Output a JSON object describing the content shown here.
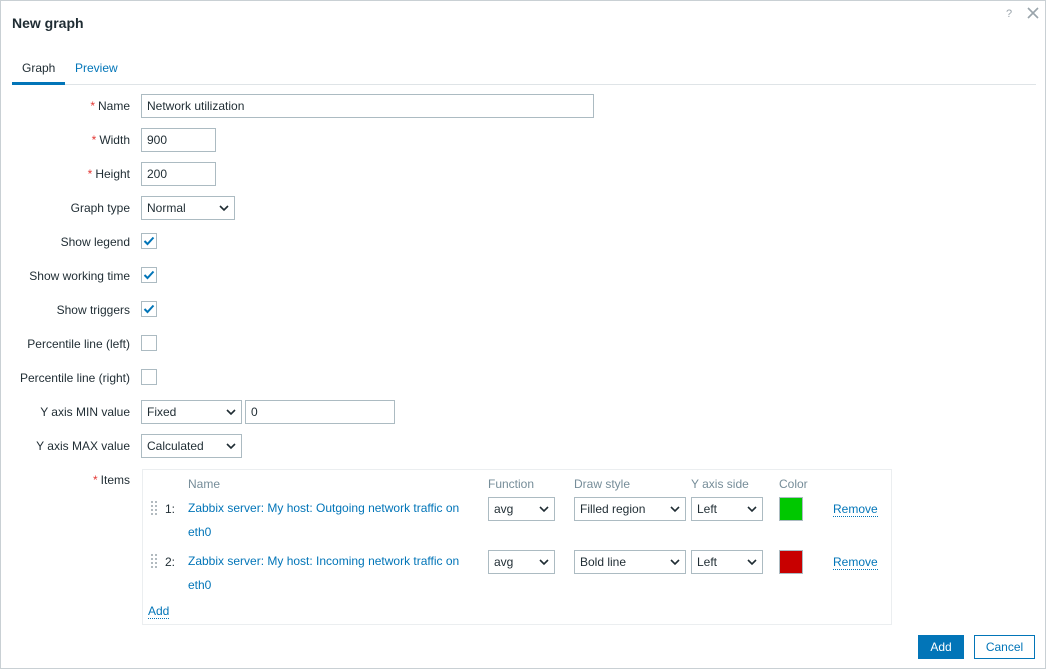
{
  "dialog": {
    "title": "New graph",
    "help": "?"
  },
  "tabs": [
    {
      "label": "Graph",
      "active": true
    },
    {
      "label": "Preview",
      "active": false
    }
  ],
  "form": {
    "name": {
      "label": "Name",
      "value": "Network utilization",
      "required": true
    },
    "width": {
      "label": "Width",
      "value": "900",
      "required": true
    },
    "height": {
      "label": "Height",
      "value": "200",
      "required": true
    },
    "graph_type": {
      "label": "Graph type",
      "value": "Normal"
    },
    "show_legend": {
      "label": "Show legend",
      "checked": true
    },
    "show_working_time": {
      "label": "Show working time",
      "checked": true
    },
    "show_triggers": {
      "label": "Show triggers",
      "checked": true
    },
    "percentile_left": {
      "label": "Percentile line (left)",
      "checked": false
    },
    "percentile_right": {
      "label": "Percentile line (right)",
      "checked": false
    },
    "y_min": {
      "label": "Y axis MIN value",
      "type": "Fixed",
      "value": "0"
    },
    "y_max": {
      "label": "Y axis MAX value",
      "type": "Calculated"
    },
    "items_label": "Items"
  },
  "items": {
    "headers": {
      "name": "Name",
      "function": "Function",
      "draw_style": "Draw style",
      "y_axis_side": "Y axis side",
      "color": "Color"
    },
    "rows": [
      {
        "num": "1:",
        "name_line1": "Zabbix server: My host: Outgoing network traffic on",
        "name_line2": "eth0",
        "function": "avg",
        "draw_style": "Filled region",
        "y_axis_side": "Left",
        "color": "#00c800",
        "remove": "Remove"
      },
      {
        "num": "2:",
        "name_line1": "Zabbix server: My host: Incoming network traffic on",
        "name_line2": "eth0",
        "function": "avg",
        "draw_style": "Bold line",
        "y_axis_side": "Left",
        "color": "#c80000",
        "remove": "Remove"
      }
    ],
    "add": "Add"
  },
  "footer": {
    "add": "Add",
    "cancel": "Cancel"
  },
  "icons": {
    "close": "close-icon",
    "help": "help-icon",
    "chevron": "chevron-down-icon",
    "check": "check-icon",
    "drag": "drag-handle-icon"
  },
  "colors": {
    "accent": "#0275b8",
    "required": "#e33734"
  }
}
